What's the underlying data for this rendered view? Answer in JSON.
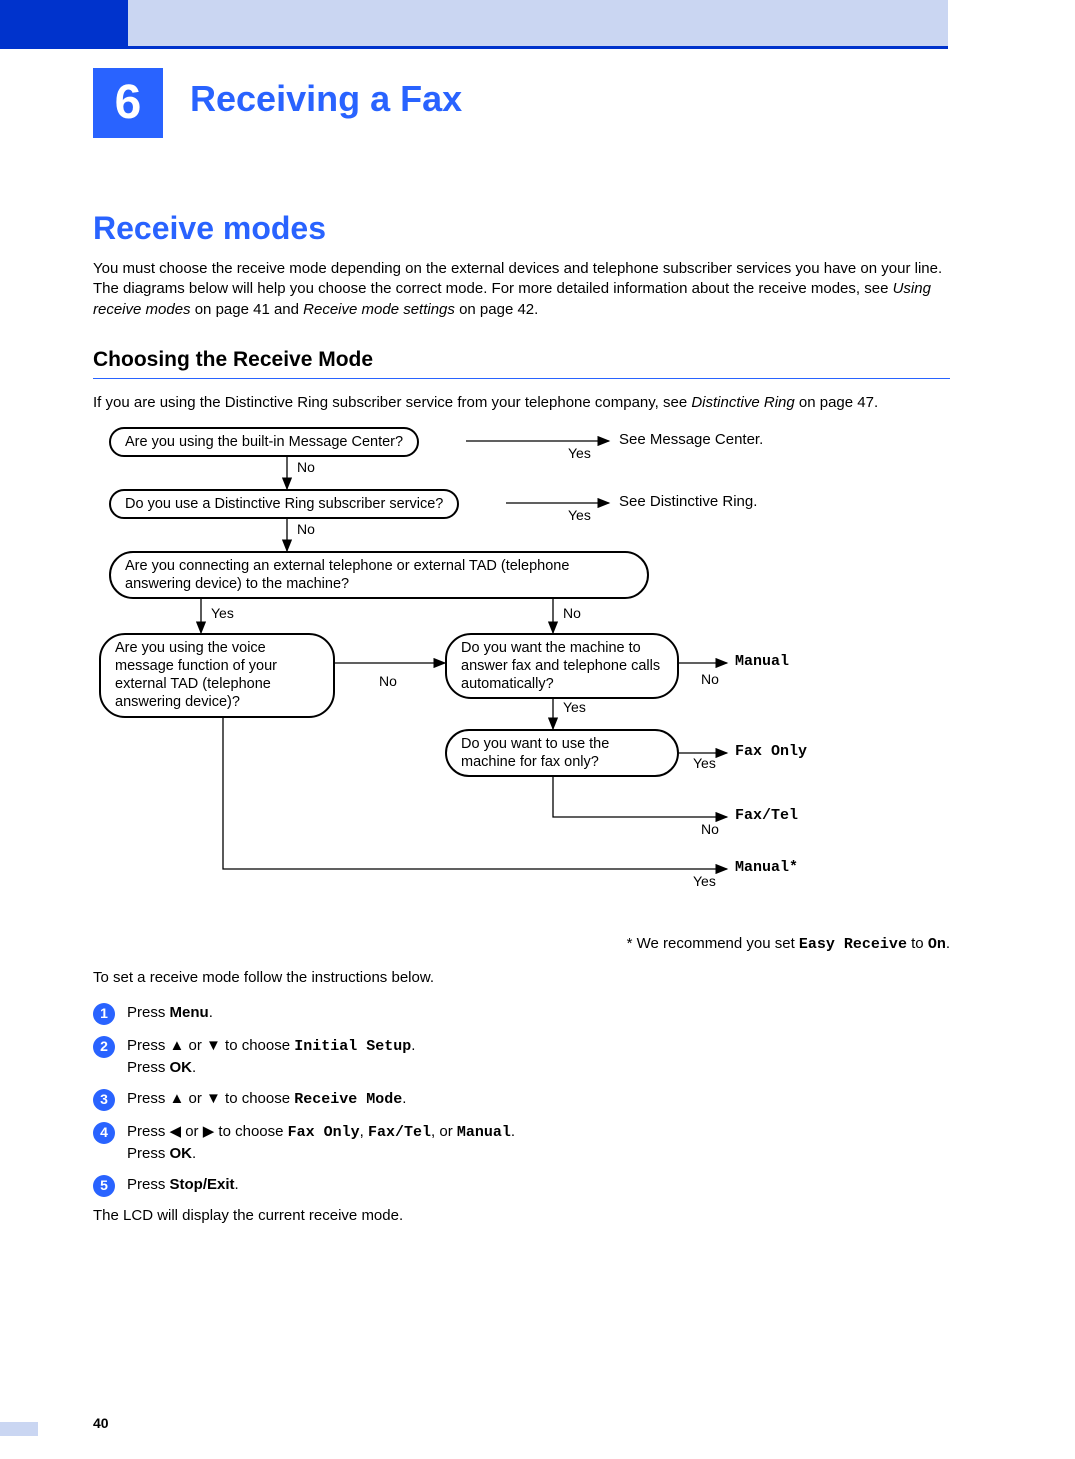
{
  "chapter": {
    "number": "6",
    "title": "Receiving a Fax"
  },
  "section_title": "Receive modes",
  "intro_a": "You must choose the receive mode depending on the external devices and telephone subscriber services you have on your line. The diagrams below will help you choose the correct mode. For more detailed information about the receive modes, see ",
  "intro_i1": "Using receive modes",
  "intro_b": " on page 41 and ",
  "intro_i2": "Receive mode settings",
  "intro_c": " on page 42.",
  "subsection_title": "Choosing the Receive Mode",
  "dist_a": "If you are using the Distinctive Ring subscriber service from your telephone company, see ",
  "dist_i": "Distinctive Ring",
  "dist_b": " on page 47.",
  "diagram": {
    "q1": "Are you using the built-in Message Center?",
    "q2": "Do you use a Distinctive Ring subscriber service?",
    "q3": "Are you connecting an external telephone or external TAD (telephone answering device) to the machine?",
    "q4": "Are you using the voice message function of your external TAD (telephone answering device)?",
    "q5": "Do you want the machine to answer fax and telephone calls automatically?",
    "q6": "Do you want to use the machine for fax only?",
    "r1": "See Message Center.",
    "r2": "See Distinctive Ring.",
    "r3": "Manual",
    "r4": "Fax Only",
    "r5": "Fax/Tel",
    "r6": "Manual*",
    "yes": "Yes",
    "no": "No"
  },
  "footnote_a": "* We recommend you set ",
  "footnote_m1": "Easy Receive",
  "footnote_b": " to ",
  "footnote_m2": "On",
  "footnote_c": ".",
  "instructions": "To set a receive mode follow the instructions below.",
  "steps": {
    "s1": {
      "a": "Press ",
      "b": "Menu",
      "c": "."
    },
    "s2": {
      "a": "Press ▲ or ▼ to choose ",
      "m": "Initial Setup",
      "b": ".",
      "c": "Press ",
      "d": "OK",
      "e": "."
    },
    "s3": {
      "a": "Press ▲ or ▼ to choose ",
      "m": "Receive Mode",
      "b": "."
    },
    "s4": {
      "a": "Press ◀ or ▶ to choose ",
      "m1": "Fax Only",
      "b": ", ",
      "m2": "Fax/Tel",
      "c": ", or ",
      "m3": "Manual",
      "d": ".",
      "e": "Press ",
      "f": "OK",
      "g": "."
    },
    "s5": {
      "a": "Press ",
      "b": "Stop/Exit",
      "c": "."
    }
  },
  "closing": "The LCD will display the current receive mode.",
  "page_number": "40"
}
